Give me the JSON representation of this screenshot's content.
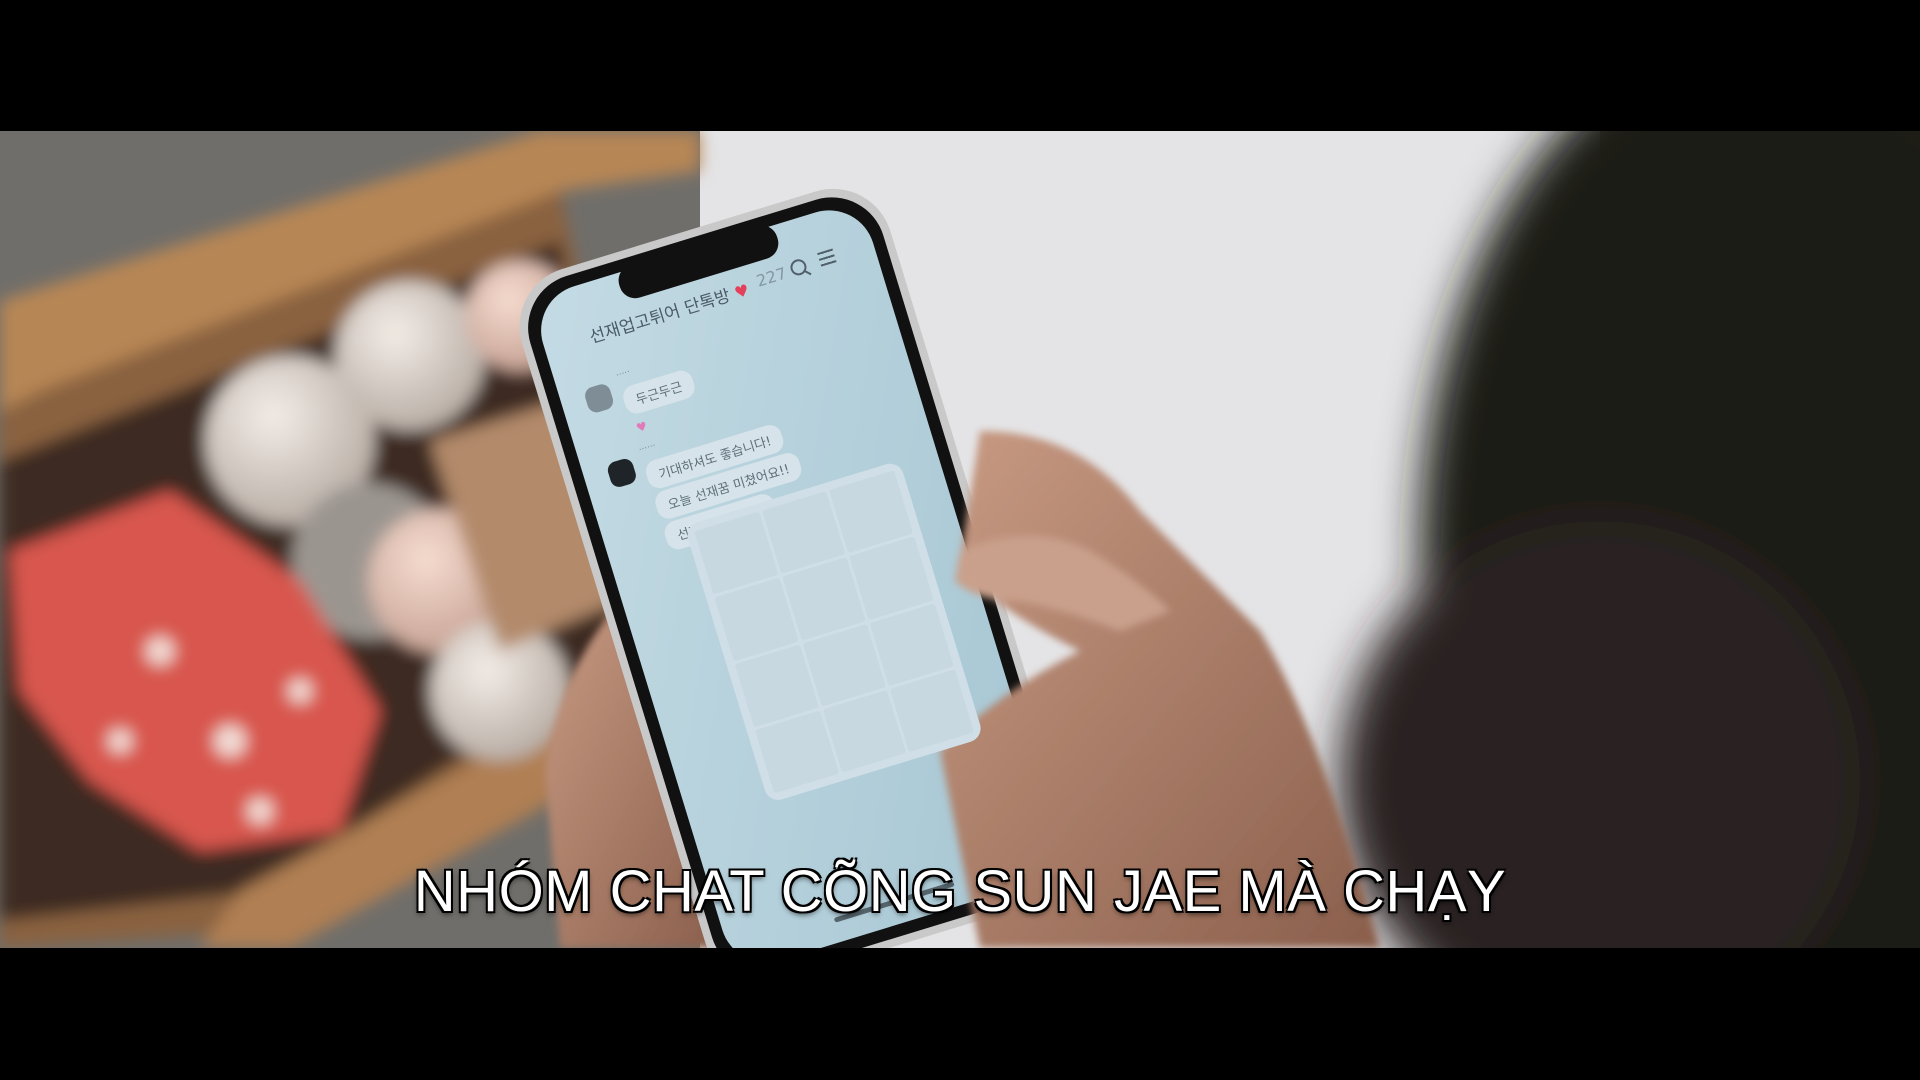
{
  "video": {
    "subtitle": "NHÓM CHAT CÕNG SUN JAE MÀ CHẠY"
  },
  "phone_screen": {
    "chat_title": "선재업고튀어 단톡방",
    "member_count": "227",
    "messages": [
      {
        "text": "두근두근"
      },
      {
        "text": "기대하셔도 좋습니다!"
      },
      {
        "text": "오늘 선재꿈 미쳤어요!!"
      },
      {
        "text": "선재 리즈 갱신!!"
      }
    ]
  },
  "colors": {
    "chat_background": "#a9c9d6",
    "bubble": "#d6e3ea",
    "heart": "#e3405a"
  }
}
